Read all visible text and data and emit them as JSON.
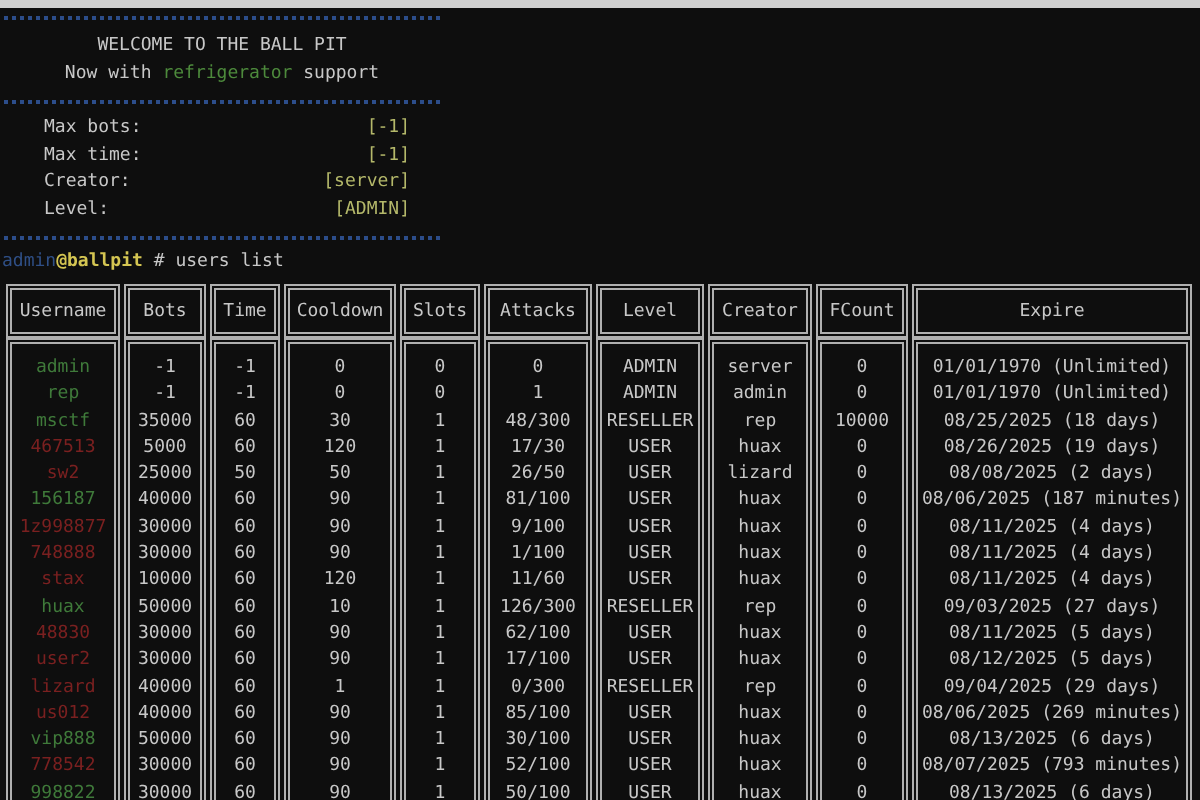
{
  "banner": {
    "title": "WELCOME TO THE BALL PIT",
    "subtitle": {
      "before": "Now with ",
      "highlight": "refrigerator",
      "after": " support"
    }
  },
  "info": [
    {
      "label": "Max bots:",
      "value": "[-1]"
    },
    {
      "label": "Max time:",
      "value": "[-1]"
    },
    {
      "label": "Creator:",
      "value": "[server]"
    },
    {
      "label": "Level:",
      "value": "[ADMIN]"
    }
  ],
  "prompt": {
    "user": "admin",
    "host": "@ballpit",
    "command": " # users list"
  },
  "table": {
    "columns": [
      "Username",
      "Bots",
      "Time",
      "Cooldown",
      "Slots",
      "Attacks",
      "Level",
      "Creator",
      "FCount",
      "Expire"
    ],
    "rows": [
      {
        "color": "#3f7a3a",
        "cells": [
          "admin",
          "-1",
          "-1",
          "0",
          "0",
          "0",
          "ADMIN",
          "server",
          "0",
          "01/01/1970 (Unlimited)"
        ]
      },
      {
        "color": "#3f7a3a",
        "cells": [
          "rep",
          "-1",
          "-1",
          "0",
          "0",
          "1",
          "ADMIN",
          "admin",
          "0",
          "01/01/1970 (Unlimited)"
        ]
      },
      {
        "color": "#3f7a3a",
        "cells": [
          "msctf",
          "35000",
          "60",
          "30",
          "1",
          "48/300",
          "RESELLER",
          "rep",
          "10000",
          "08/25/2025 (18 days)"
        ]
      },
      {
        "color": "#7a2020",
        "cells": [
          "467513",
          "5000",
          "60",
          "120",
          "1",
          "17/30",
          "USER",
          "huax",
          "0",
          "08/26/2025 (19 days)"
        ]
      },
      {
        "color": "#7a2020",
        "cells": [
          "sw2",
          "25000",
          "50",
          "50",
          "1",
          "26/50",
          "USER",
          "lizard",
          "0",
          "08/08/2025 (2 days)"
        ]
      },
      {
        "color": "#3f7a3a",
        "cells": [
          "156187",
          "40000",
          "60",
          "90",
          "1",
          "81/100",
          "USER",
          "huax",
          "0",
          "08/06/2025 (187 minutes)"
        ]
      },
      {
        "color": "#7a2020",
        "cells": [
          "1z998877",
          "30000",
          "60",
          "90",
          "1",
          "9/100",
          "USER",
          "huax",
          "0",
          "08/11/2025 (4 days)"
        ]
      },
      {
        "color": "#7a2020",
        "cells": [
          "748888",
          "30000",
          "60",
          "90",
          "1",
          "1/100",
          "USER",
          "huax",
          "0",
          "08/11/2025 (4 days)"
        ]
      },
      {
        "color": "#7a2020",
        "cells": [
          "stax",
          "10000",
          "60",
          "120",
          "1",
          "11/60",
          "USER",
          "huax",
          "0",
          "08/11/2025 (4 days)"
        ]
      },
      {
        "color": "#3f7a3a",
        "cells": [
          "huax",
          "50000",
          "60",
          "10",
          "1",
          "126/300",
          "RESELLER",
          "rep",
          "0",
          "09/03/2025 (27 days)"
        ]
      },
      {
        "color": "#7a2020",
        "cells": [
          "48830",
          "30000",
          "60",
          "90",
          "1",
          "62/100",
          "USER",
          "huax",
          "0",
          "08/11/2025 (5 days)"
        ]
      },
      {
        "color": "#7a2020",
        "cells": [
          "user2",
          "30000",
          "60",
          "90",
          "1",
          "17/100",
          "USER",
          "huax",
          "0",
          "08/12/2025 (5 days)"
        ]
      },
      {
        "color": "#7a2020",
        "cells": [
          "lizard",
          "40000",
          "60",
          "1",
          "1",
          "0/300",
          "RESELLER",
          "rep",
          "0",
          "09/04/2025 (29 days)"
        ]
      },
      {
        "color": "#7a2020",
        "cells": [
          "us012",
          "40000",
          "60",
          "90",
          "1",
          "85/100",
          "USER",
          "huax",
          "0",
          "08/06/2025 (269 minutes)"
        ]
      },
      {
        "color": "#3f7a3a",
        "cells": [
          "vip888",
          "50000",
          "60",
          "90",
          "1",
          "30/100",
          "USER",
          "huax",
          "0",
          "08/13/2025 (6 days)"
        ]
      },
      {
        "color": "#7a2020",
        "cells": [
          "778542",
          "30000",
          "60",
          "90",
          "1",
          "52/100",
          "USER",
          "huax",
          "0",
          "08/07/2025 (793 minutes)"
        ]
      },
      {
        "color": "#3f7a3a",
        "cells": [
          "998822",
          "30000",
          "60",
          "90",
          "1",
          "50/100",
          "USER",
          "huax",
          "0",
          "08/13/2025 (6 days)"
        ]
      }
    ]
  }
}
